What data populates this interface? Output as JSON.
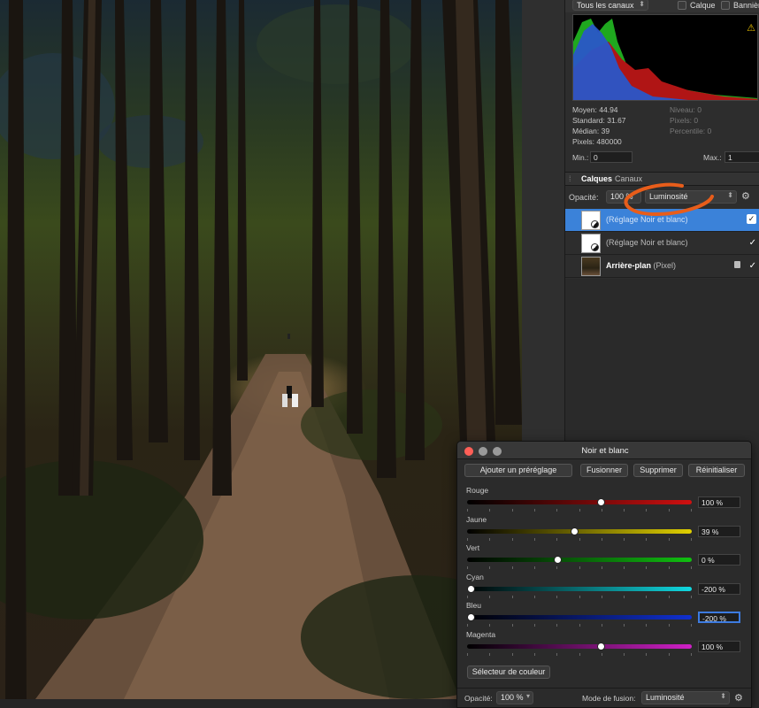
{
  "histogram": {
    "channel_select": "Tous les canaux",
    "checkbox_layer": "Calque",
    "checkbox_banner": "Bannière",
    "stats_left": [
      {
        "label": "Moyen:",
        "value": "44.94"
      },
      {
        "label": "Standard:",
        "value": "31.67"
      },
      {
        "label": "Médian:",
        "value": "39"
      },
      {
        "label": "Pixels:",
        "value": "480000"
      }
    ],
    "stats_right": [
      {
        "label": "Niveau:",
        "value": "0"
      },
      {
        "label": "Pixels:",
        "value": "0"
      },
      {
        "label": "Percentile:",
        "value": "0"
      }
    ],
    "min_label": "Min.:",
    "min_value": "0",
    "max_label": "Max.:",
    "max_value": "1"
  },
  "layers_panel": {
    "tabs": [
      "Calques",
      "Canaux"
    ],
    "opacity_label": "Opacité:",
    "opacity_value": "100 %",
    "blend_mode": "Luminosité",
    "layers": [
      {
        "name": "(Réglage Noir et blanc)",
        "selected": true
      },
      {
        "name": "(Réglage Noir et blanc)",
        "selected": false
      },
      {
        "name_bold": "Arrière-plan",
        "name_suffix": " (Pixel)",
        "selected": false
      }
    ]
  },
  "dialog": {
    "title": "Noir et blanc",
    "buttons": {
      "add_preset": "Ajouter un préréglage",
      "merge": "Fusionner",
      "delete": "Supprimer",
      "reset": "Réinitialiser"
    },
    "sliders": [
      {
        "label": "Rouge",
        "value": "100 %",
        "level": 100,
        "color": "#d01010"
      },
      {
        "label": "Jaune",
        "value": "39 %",
        "level": 39,
        "color": "#e0d000"
      },
      {
        "label": "Vert",
        "value": "0 %",
        "level": 0,
        "color": "#10c010"
      },
      {
        "label": "Cyan",
        "value": "-200 %",
        "level": -200,
        "color": "#10d8e0"
      },
      {
        "label": "Bleu",
        "value": "-200 %",
        "level": -200,
        "color": "#1030d0"
      },
      {
        "label": "Magenta",
        "value": "100 %",
        "level": 100,
        "color": "#d020c8"
      }
    ],
    "color_picker": "Sélecteur de couleur",
    "footer": {
      "opacity_label": "Opacité:",
      "opacity_value": "100 %",
      "blend_label": "Mode de fusion:",
      "blend_value": "Luminosité"
    }
  },
  "colors": {
    "accent_selection": "#3b82d9",
    "annotation_stroke": "#e85d1a"
  }
}
